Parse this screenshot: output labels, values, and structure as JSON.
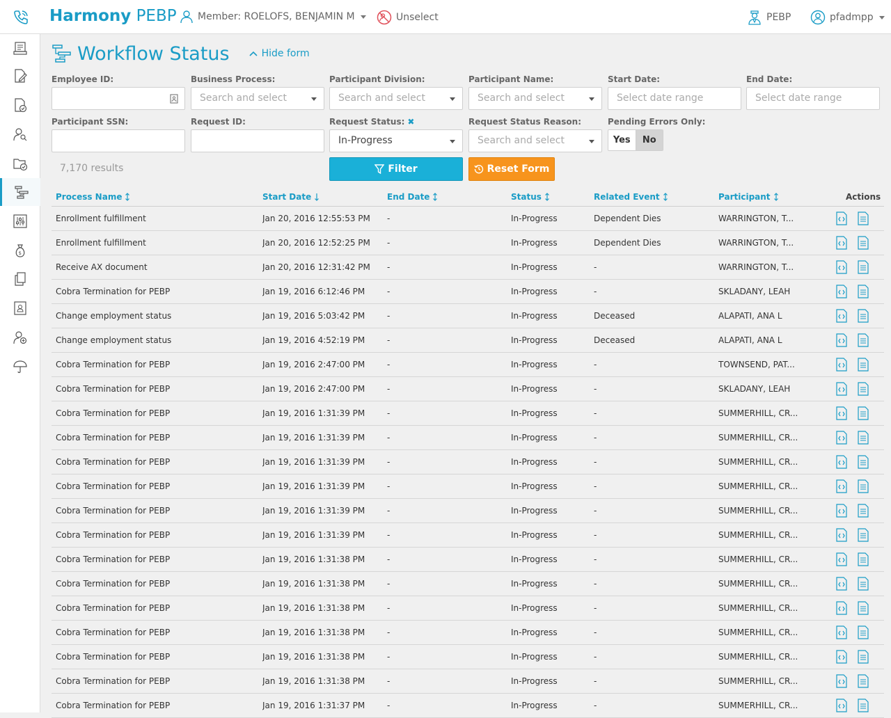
{
  "header": {
    "brand_bold": "Harmony",
    "brand_light": "PEBP",
    "member_label": "Member: ROELOFS, BENJAMIN M",
    "unselect_label": "Unselect",
    "org_label": "PEBP",
    "user_label": "pfadmpp"
  },
  "page": {
    "title": "Workflow Status",
    "hide_form_label": "Hide form"
  },
  "form": {
    "employee_id": {
      "label": "Employee ID:",
      "value": ""
    },
    "business_process": {
      "label": "Business Process:",
      "placeholder": "Search and select"
    },
    "participant_division": {
      "label": "Participant Division:",
      "placeholder": "Search and select"
    },
    "participant_name": {
      "label": "Participant Name:",
      "placeholder": "Search and select"
    },
    "start_date": {
      "label": "Start Date:",
      "placeholder": "Select date range"
    },
    "end_date": {
      "label": "End Date:",
      "placeholder": "Select date range"
    },
    "participant_ssn": {
      "label": "Participant SSN:",
      "value": ""
    },
    "request_id": {
      "label": "Request ID:",
      "value": ""
    },
    "request_status": {
      "label": "Request Status:",
      "clear_glyph": "✖",
      "value": "In-Progress"
    },
    "request_status_reason": {
      "label": "Request Status Reason:",
      "placeholder": "Search and select"
    },
    "pending_errors": {
      "label": "Pending Errors Only:",
      "yes": "Yes",
      "no": "No",
      "selected": "No"
    },
    "results_text": "7,170 results",
    "filter_label": "Filter",
    "reset_label": "Reset Form"
  },
  "table": {
    "columns": {
      "process_name": "Process Name",
      "start_date": "Start Date",
      "end_date": "End Date",
      "status": "Status",
      "related_event": "Related Event",
      "participant": "Participant",
      "actions": "Actions"
    },
    "rows": [
      [
        "Enrollment fulfillment",
        "Jan 20, 2016 12:55:53 PM",
        "-",
        "In-Progress",
        "Dependent Dies",
        "WARRINGTON, T..."
      ],
      [
        "Enrollment fulfillment",
        "Jan 20, 2016 12:52:25 PM",
        "-",
        "In-Progress",
        "Dependent Dies",
        "WARRINGTON, T..."
      ],
      [
        "Receive AX document",
        "Jan 20, 2016 12:31:42 PM",
        "-",
        "In-Progress",
        "-",
        "WARRINGTON, T..."
      ],
      [
        "Cobra Termination for PEBP",
        "Jan 19, 2016 6:12:46 PM",
        "-",
        "In-Progress",
        "-",
        "SKLADANY, LEAH"
      ],
      [
        "Change employment status",
        "Jan 19, 2016 5:03:42 PM",
        "-",
        "In-Progress",
        "Deceased",
        "ALAPATI, ANA L"
      ],
      [
        "Change employment status",
        "Jan 19, 2016 4:52:19 PM",
        "-",
        "In-Progress",
        "Deceased",
        "ALAPATI, ANA L"
      ],
      [
        "Cobra Termination for PEBP",
        "Jan 19, 2016 2:47:00 PM",
        "-",
        "In-Progress",
        "-",
        "TOWNSEND, PAT..."
      ],
      [
        "Cobra Termination for PEBP",
        "Jan 19, 2016 2:47:00 PM",
        "-",
        "In-Progress",
        "-",
        "SKLADANY, LEAH"
      ],
      [
        "Cobra Termination for PEBP",
        "Jan 19, 2016 1:31:39 PM",
        "-",
        "In-Progress",
        "-",
        "SUMMERHILL, CR..."
      ],
      [
        "Cobra Termination for PEBP",
        "Jan 19, 2016 1:31:39 PM",
        "-",
        "In-Progress",
        "-",
        "SUMMERHILL, CR..."
      ],
      [
        "Cobra Termination for PEBP",
        "Jan 19, 2016 1:31:39 PM",
        "-",
        "In-Progress",
        "-",
        "SUMMERHILL, CR..."
      ],
      [
        "Cobra Termination for PEBP",
        "Jan 19, 2016 1:31:39 PM",
        "-",
        "In-Progress",
        "-",
        "SUMMERHILL, CR..."
      ],
      [
        "Cobra Termination for PEBP",
        "Jan 19, 2016 1:31:39 PM",
        "-",
        "In-Progress",
        "-",
        "SUMMERHILL, CR..."
      ],
      [
        "Cobra Termination for PEBP",
        "Jan 19, 2016 1:31:39 PM",
        "-",
        "In-Progress",
        "-",
        "SUMMERHILL, CR..."
      ],
      [
        "Cobra Termination for PEBP",
        "Jan 19, 2016 1:31:38 PM",
        "-",
        "In-Progress",
        "-",
        "SUMMERHILL, CR..."
      ],
      [
        "Cobra Termination for PEBP",
        "Jan 19, 2016 1:31:38 PM",
        "-",
        "In-Progress",
        "-",
        "SUMMERHILL, CR..."
      ],
      [
        "Cobra Termination for PEBP",
        "Jan 19, 2016 1:31:38 PM",
        "-",
        "In-Progress",
        "-",
        "SUMMERHILL, CR..."
      ],
      [
        "Cobra Termination for PEBP",
        "Jan 19, 2016 1:31:38 PM",
        "-",
        "In-Progress",
        "-",
        "SUMMERHILL, CR..."
      ],
      [
        "Cobra Termination for PEBP",
        "Jan 19, 2016 1:31:38 PM",
        "-",
        "In-Progress",
        "-",
        "SUMMERHILL, CR..."
      ],
      [
        "Cobra Termination for PEBP",
        "Jan 19, 2016 1:31:38 PM",
        "-",
        "In-Progress",
        "-",
        "SUMMERHILL, CR..."
      ],
      [
        "Cobra Termination for PEBP",
        "Jan 19, 2016 1:31:37 PM",
        "-",
        "In-Progress",
        "-",
        "SUMMERHILL, CR..."
      ]
    ]
  },
  "sidebar": {
    "icons": [
      "dashboard-icon",
      "edit-document-icon",
      "document-check-icon",
      "person-search-icon",
      "folder-check-icon",
      "workflow-icon",
      "sliders-icon",
      "money-bag-icon",
      "copy-document-icon",
      "id-card-icon",
      "add-user-icon",
      "umbrella-icon"
    ],
    "active_index": 5
  },
  "colors": {
    "accent": "#1a9cc6",
    "filter_button": "#1ab0d8",
    "reset_button": "#f7941d",
    "unselect_icon": "#e0505a"
  }
}
